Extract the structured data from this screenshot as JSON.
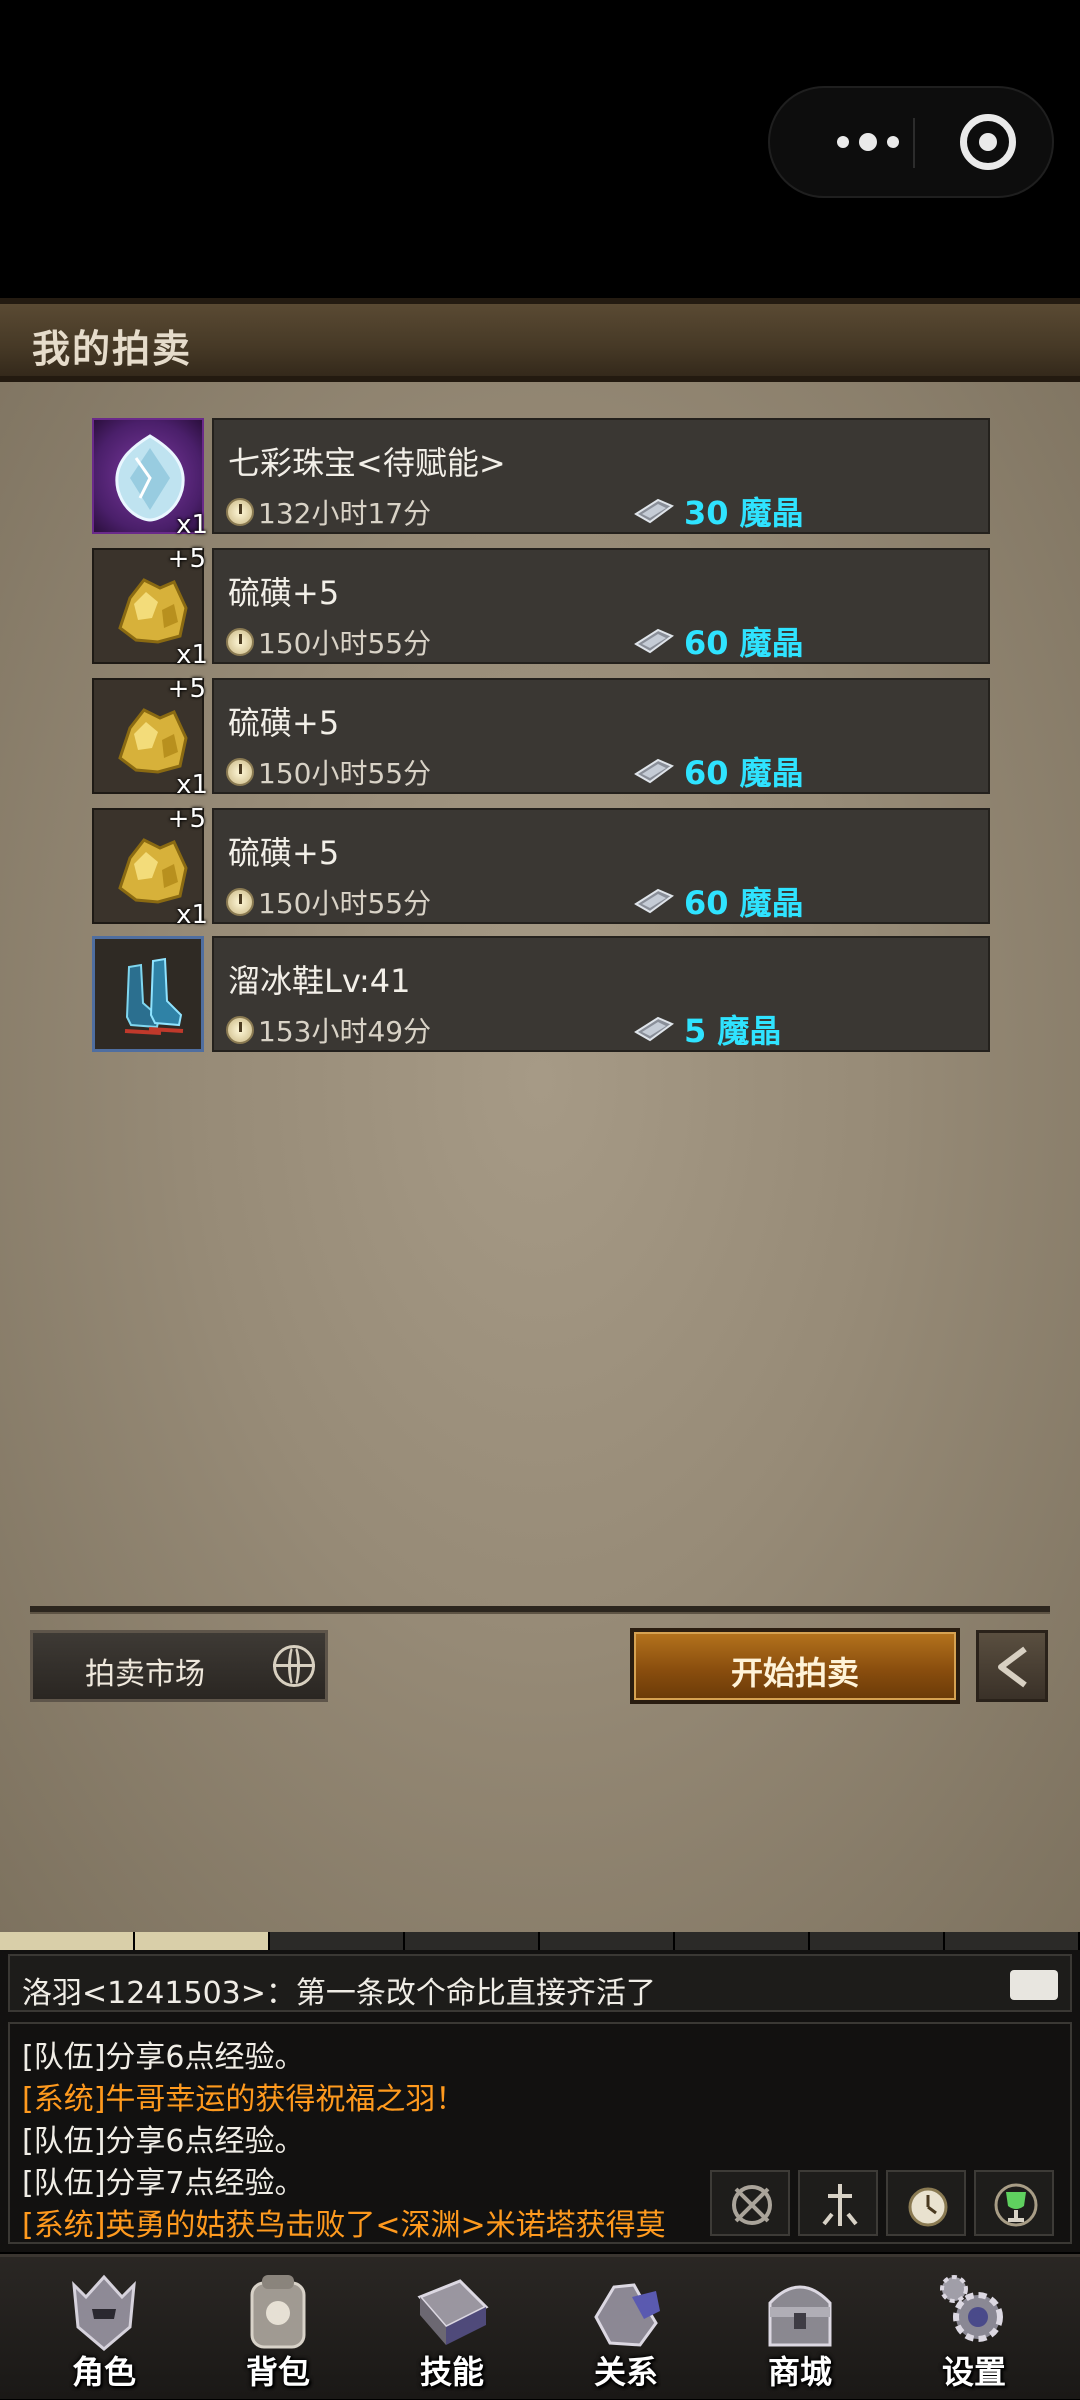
{
  "capsule": {
    "more_icon": "more-dots-icon",
    "close_icon": "target-close-icon"
  },
  "header": {
    "title": "我的拍卖"
  },
  "auctions": [
    {
      "name": "七彩珠宝<待赋能>",
      "time": "132小时17分",
      "price": "30 魔晶",
      "qty": "x1",
      "plus": "",
      "icon": "jewel-icon"
    },
    {
      "name": "硫磺+5",
      "time": "150小时55分",
      "price": "60 魔晶",
      "qty": "x1",
      "plus": "+5",
      "icon": "sulfur-icon"
    },
    {
      "name": "硫磺+5",
      "time": "150小时55分",
      "price": "60 魔晶",
      "qty": "x1",
      "plus": "+5",
      "icon": "sulfur-icon"
    },
    {
      "name": "硫磺+5",
      "time": "150小时55分",
      "price": "60 魔晶",
      "qty": "x1",
      "plus": "+5",
      "icon": "sulfur-icon"
    },
    {
      "name": "溜冰鞋Lv:41",
      "time": "153小时49分",
      "price": "5 魔晶",
      "qty": "",
      "plus": "",
      "icon": "skates-icon"
    }
  ],
  "actions": {
    "market_label": "拍卖市场",
    "start_label": "开始拍卖",
    "back_icon": "back-arrow-icon"
  },
  "chat": {
    "input_message": "洛羽<1241503>：第一条改个命比直接齐活了",
    "log": [
      {
        "text": "[队伍]分享6点经验。",
        "color": "white"
      },
      {
        "text": "[系统]牛哥幸运的获得祝福之羽！",
        "color": "orange"
      },
      {
        "text": "[队伍]分享6点经验。",
        "color": "white"
      },
      {
        "text": "[队伍]分享7点经验。",
        "color": "white"
      },
      {
        "text": "[系统]英勇的姑获鸟击败了<深渊>米诺塔获得莫",
        "color": "orange"
      }
    ]
  },
  "nav": [
    {
      "label": "角色",
      "icon": "helmet-icon"
    },
    {
      "label": "背包",
      "icon": "backpack-icon"
    },
    {
      "label": "技能",
      "icon": "skill-book-icon"
    },
    {
      "label": "关系",
      "icon": "gauntlet-icon"
    },
    {
      "label": "商城",
      "icon": "chest-icon"
    },
    {
      "label": "设置",
      "icon": "gear-icon"
    }
  ],
  "colors": {
    "price": "#2fe3ff",
    "system_msg": "#ff9a1e",
    "start_button": "#a8661a"
  }
}
